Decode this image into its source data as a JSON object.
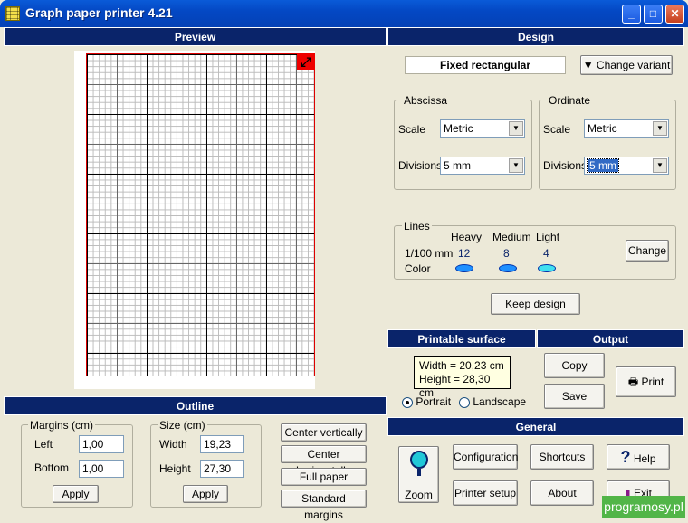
{
  "window": {
    "title": "Graph paper printer 4.21"
  },
  "preview": {
    "header": "Preview"
  },
  "design": {
    "header": "Design",
    "variant_name": "Fixed rectangular",
    "change_variant_label": "Change variant",
    "abscissa": {
      "label": "Abscissa",
      "scale_label": "Scale",
      "scale_value": "Metric",
      "divisions_label": "Divisions",
      "divisions_value": "5 mm"
    },
    "ordinate": {
      "label": "Ordinate",
      "scale_label": "Scale",
      "scale_value": "Metric",
      "divisions_label": "Divisions",
      "divisions_value": "5 mm"
    },
    "lines": {
      "label": "Lines",
      "row_label": "1/100 mm",
      "color_label": "Color",
      "heavy": {
        "label": "Heavy",
        "value": "12",
        "color": "#1e90ff"
      },
      "medium": {
        "label": "Medium",
        "value": "8",
        "color": "#1e90ff"
      },
      "light": {
        "label": "Light",
        "value": "4",
        "color": "#40e0f0"
      },
      "change_label": "Change"
    },
    "keep_design_label": "Keep design"
  },
  "printable": {
    "header": "Printable surface",
    "width_text": "Width = 20,23 cm",
    "height_text": "Height = 28,30 cm",
    "portrait_label": "Portrait",
    "landscape_label": "Landscape"
  },
  "output": {
    "header": "Output",
    "copy_label": "Copy",
    "save_label": "Save",
    "print_label": "Print"
  },
  "outline": {
    "header": "Outline",
    "margins": {
      "label": "Margins (cm)",
      "left_label": "Left",
      "left_value": "1,00",
      "bottom_label": "Bottom",
      "bottom_value": "1,00",
      "apply_label": "Apply"
    },
    "size": {
      "label": "Size (cm)",
      "width_label": "Width",
      "width_value": "19,23",
      "height_label": "Height",
      "height_value": "27,30",
      "apply_label": "Apply"
    },
    "center_vertically": "Center vertically",
    "center_horizontally": "Center horizontally",
    "full_paper": "Full paper",
    "standard_margins": "Standard margins"
  },
  "general": {
    "header": "General",
    "zoom_label": "Zoom",
    "configuration_label": "Configuration",
    "shortcuts_label": "Shortcuts",
    "help_label": "Help",
    "printer_setup_label": "Printer setup",
    "about_label": "About",
    "exit_label": "Exit"
  },
  "watermark": "programosy.pl"
}
